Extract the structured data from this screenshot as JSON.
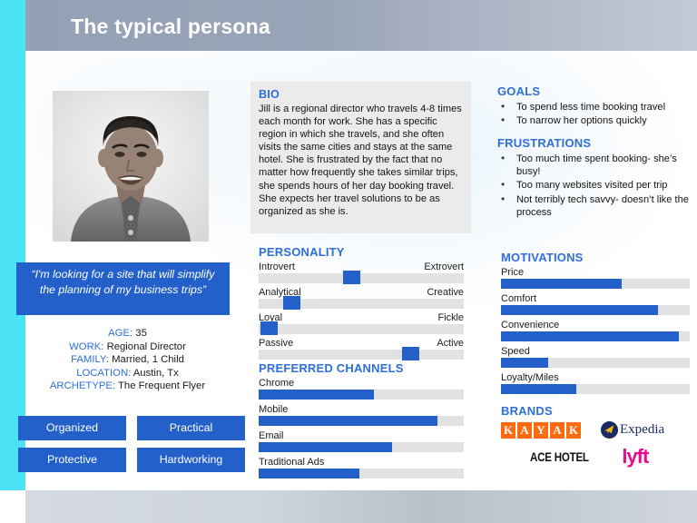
{
  "header": {
    "title": "The typical persona",
    "bar_color": "#94a0b4",
    "accent_color": "#4ce3f7"
  },
  "theme": {
    "blue": "#2360ca",
    "heading_blue": "#2e6fd8",
    "track_grey": "#e2e2e2",
    "card_grey": "#ebebeb"
  },
  "persona": {
    "photo_alt": "smiling-man-portrait",
    "quote": "“I'm looking for a site that will simplify the planning of my business trips”",
    "demographics": [
      {
        "label": "AGE:",
        "value": "35"
      },
      {
        "label": "WORK:",
        "value": "Regional Director"
      },
      {
        "label": "FAMILY:",
        "value": "Married, 1 Child"
      },
      {
        "label": "LOCATION:",
        "value": "Austin, Tx"
      },
      {
        "label": "ARCHETYPE:",
        "value": "The Frequent Flyer"
      }
    ],
    "traits": [
      "Organized",
      "Practical",
      "Protective",
      "Hardworking"
    ]
  },
  "bio": {
    "heading": "BIO",
    "text": "Jill is a regional director who travels 4-8 times each month for work.  She has a specific region in which she travels, and she often visits the same cities and stays at the same hotel. She is frustrated by the fact that no matter how frequently she takes similar trips, she spends hours of her day booking travel. She expects her travel solutions to be as organized as she is."
  },
  "personality": {
    "heading": "PERSONALITY",
    "rows": [
      {
        "left": "Introvert",
        "right": "Extrovert",
        "position": 41
      },
      {
        "left": "Analytical",
        "right": "Creative",
        "position": 12
      },
      {
        "left": "Loyal",
        "right": "Fickle",
        "position": 2
      },
      {
        "left": "Passive",
        "right": "Active",
        "position": 70
      }
    ]
  },
  "channels": {
    "heading": "PREFERRED CHANNELS",
    "rows": [
      {
        "label": "Chrome",
        "value": 56
      },
      {
        "label": "Mobile",
        "value": 87
      },
      {
        "label": "Email",
        "value": 65
      },
      {
        "label": "Traditional Ads",
        "value": 49
      }
    ]
  },
  "goals": {
    "heading": "GOALS",
    "items": [
      "To spend less time booking travel",
      "To narrow her options quickly"
    ]
  },
  "frustrations": {
    "heading": "FRUSTRATIONS",
    "items": [
      "Too much time spent booking- she’s busy!",
      "Too many websites visited per trip",
      "Not terribly tech savvy- doesn’t like the process"
    ]
  },
  "motivations": {
    "heading": "MOTIVATIONS",
    "rows": [
      {
        "label": "Price",
        "value": 64
      },
      {
        "label": "Comfort",
        "value": 83
      },
      {
        "label": "Convenience",
        "value": 94
      },
      {
        "label": "Speed",
        "value": 25
      },
      {
        "label": "Loyalty/Miles",
        "value": 40
      }
    ]
  },
  "brands": {
    "heading": "BRANDS",
    "items": [
      {
        "name": "KAYAK",
        "letters": [
          "K",
          "A",
          "Y",
          "A",
          "K"
        ],
        "color": "#ff690f"
      },
      {
        "name": "Expedia",
        "word": "Expedia",
        "color": "#1b2a5e"
      },
      {
        "name": "ACE HOTEL",
        "word": "ACE HOTEL",
        "color": "#111111"
      },
      {
        "name": "lyft",
        "word": "lyft",
        "color": "#ea0b8c"
      }
    ]
  }
}
